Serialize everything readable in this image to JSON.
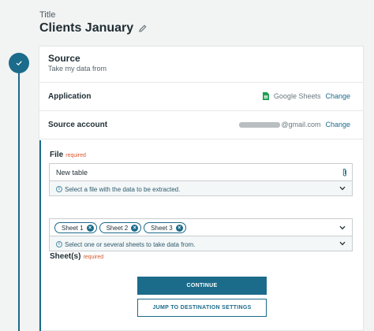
{
  "header": {
    "title_label": "Title",
    "title": "Clients January",
    "edit_icon": "pencil-icon"
  },
  "step": {
    "icon": "check-icon",
    "title": "Source",
    "subtitle": "Take my data from"
  },
  "application": {
    "label": "Application",
    "value": "Google Sheets",
    "icon": "google-sheets-icon",
    "change": "Change"
  },
  "account": {
    "label": "Source account",
    "value": "@gmail.com",
    "change": "Change"
  },
  "file": {
    "label": "File",
    "required": "required",
    "value": "New table",
    "hint": "Select a file with the data to be extracted."
  },
  "sheets": {
    "label": "Sheet(s)",
    "required": "required",
    "chips": [
      "Sheet 1",
      "Sheet 2",
      "Sheet 3"
    ],
    "hint": "Select one or several sheets to take data from."
  },
  "actions": {
    "continue": "CONTINUE",
    "jump": "JUMP TO DESTINATION SETTINGS"
  },
  "colors": {
    "accent": "#1b6b8a",
    "required": "#d9572b",
    "sheets_green": "#1e9e52"
  }
}
